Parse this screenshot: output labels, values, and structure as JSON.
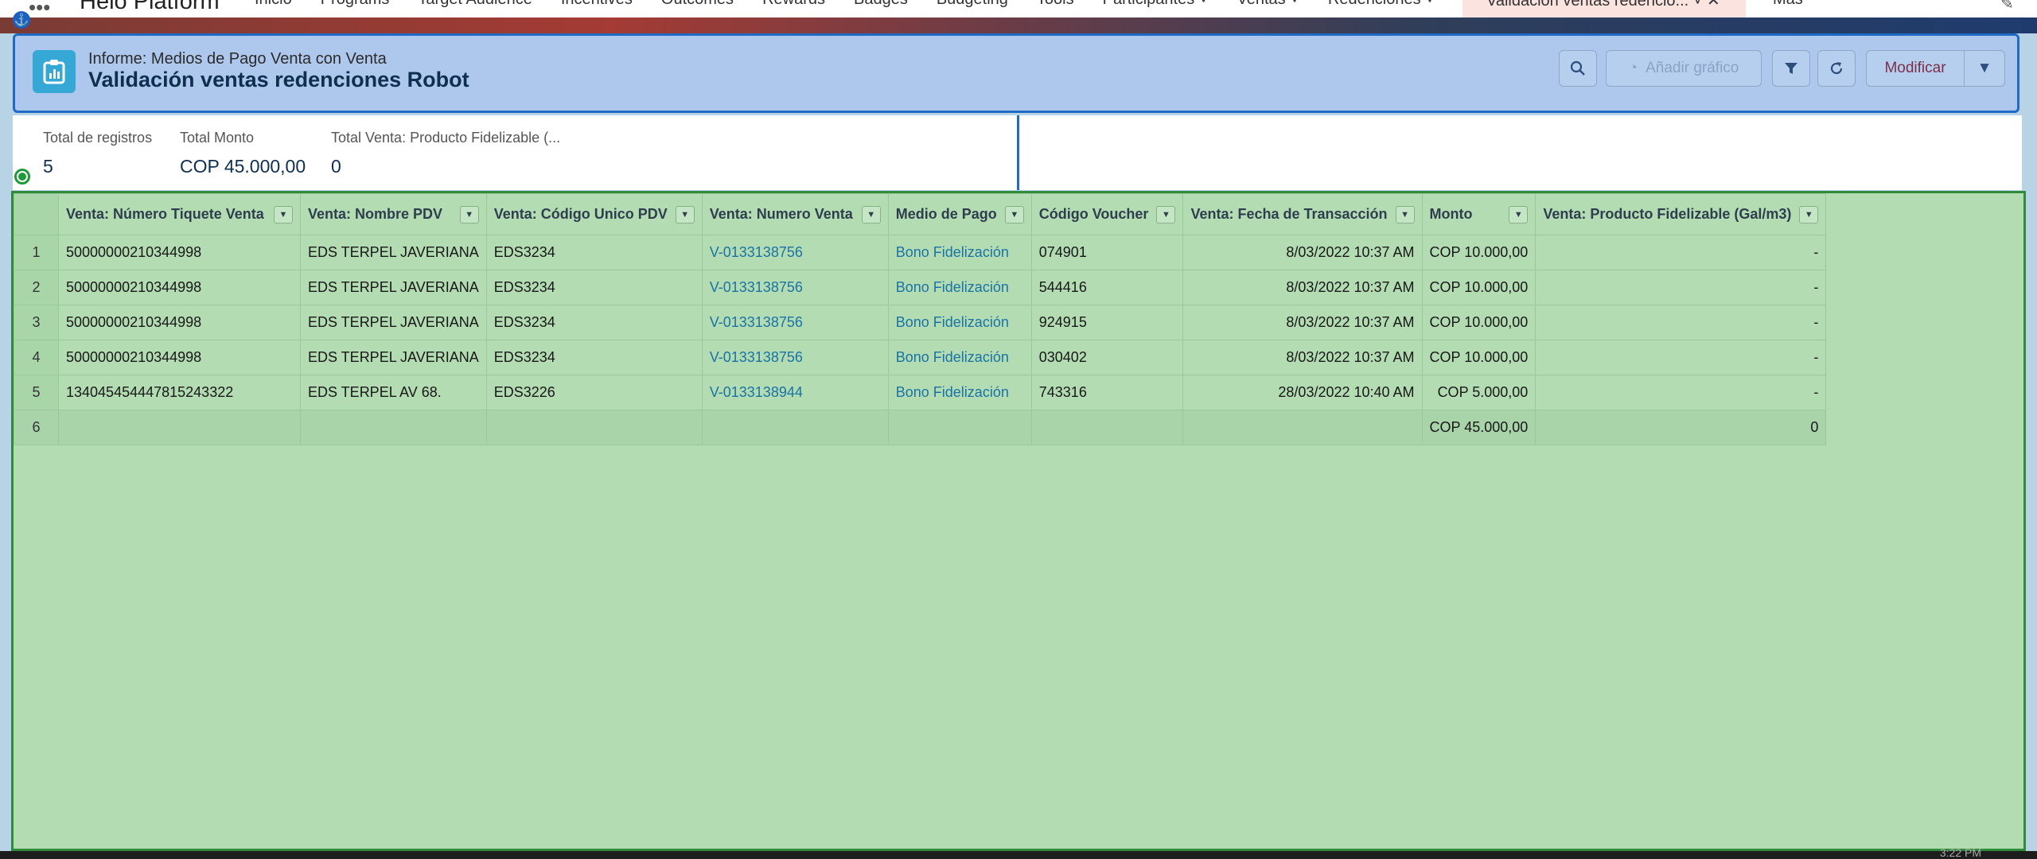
{
  "nav": {
    "app_name": "Helo Platform",
    "items": [
      "Inicio",
      "Programs",
      "Target Audience",
      "Incentives",
      "Outcomes",
      "Rewards",
      "Badges",
      "Budgeting",
      "Tools",
      "Participantes ˅",
      "Ventas ˅",
      "Redenciones ˅"
    ],
    "active_tab": "Validación ventas redencio...  ˅  ✕",
    "more": "Más"
  },
  "header": {
    "subtitle": "Informe: Medios de Pago Venta con Venta",
    "title": "Validación ventas redenciones Robot",
    "add_chart_label": "Añadir gráfico",
    "edit_label": "Modificar"
  },
  "summary": [
    {
      "label": "Total de registros",
      "value": "5"
    },
    {
      "label": "Total Monto",
      "value": "COP 45.000,00"
    },
    {
      "label": "Total Venta: Producto Fidelizable (...",
      "value": "0"
    }
  ],
  "table": {
    "columns": [
      "Venta: Número Tiquete Venta",
      "Venta: Nombre PDV",
      "Venta: Código Unico PDV",
      "Venta: Numero Venta",
      "Medio de Pago",
      "Código Voucher",
      "Venta: Fecha de Transacción",
      "Monto",
      "Venta: Producto Fidelizable (Gal/m3)"
    ],
    "rows": [
      {
        "n": "1",
        "ticket": "50000000210344998",
        "pdv": "EDS TERPEL JAVERIANA",
        "code": "EDS3234",
        "sale": "V-0133138756",
        "pay": "Bono Fidelización",
        "voucher": "074901",
        "date": "8/03/2022 10:37 AM",
        "amount": "COP 10.000,00",
        "prod": "-"
      },
      {
        "n": "2",
        "ticket": "50000000210344998",
        "pdv": "EDS TERPEL JAVERIANA",
        "code": "EDS3234",
        "sale": "V-0133138756",
        "pay": "Bono Fidelización",
        "voucher": "544416",
        "date": "8/03/2022 10:37 AM",
        "amount": "COP 10.000,00",
        "prod": "-"
      },
      {
        "n": "3",
        "ticket": "50000000210344998",
        "pdv": "EDS TERPEL JAVERIANA",
        "code": "EDS3234",
        "sale": "V-0133138756",
        "pay": "Bono Fidelización",
        "voucher": "924915",
        "date": "8/03/2022 10:37 AM",
        "amount": "COP 10.000,00",
        "prod": "-"
      },
      {
        "n": "4",
        "ticket": "50000000210344998",
        "pdv": "EDS TERPEL JAVERIANA",
        "code": "EDS3234",
        "sale": "V-0133138756",
        "pay": "Bono Fidelización",
        "voucher": "030402",
        "date": "8/03/2022 10:37 AM",
        "amount": "COP 10.000,00",
        "prod": "-"
      },
      {
        "n": "5",
        "ticket": "13404545444781524332​2",
        "pdv": "EDS TERPEL AV 68.",
        "code": "EDS3226",
        "sale": "V-0133138944",
        "pay": "Bono Fidelización",
        "voucher": "743316",
        "date": "28/03/2022 10:40 AM",
        "amount": "COP 5.000,00",
        "prod": "-"
      }
    ],
    "total": {
      "n": "6",
      "amount": "COP 45.000,00",
      "prod": "0"
    }
  },
  "taskbar": {
    "time": "3:22 PM"
  }
}
